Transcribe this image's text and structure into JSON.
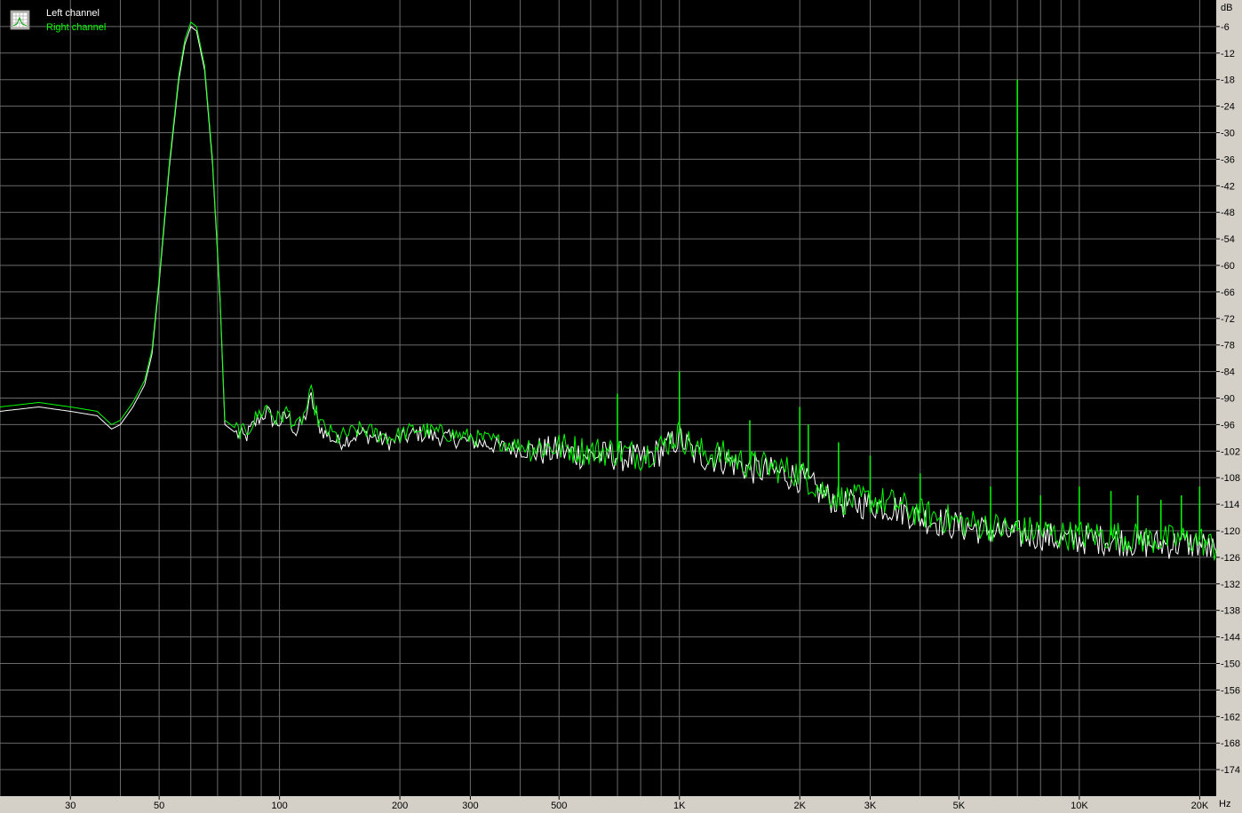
{
  "legend": {
    "left_label": "Left channel",
    "right_label": "Right channel",
    "icon": "spectrum-settings-icon"
  },
  "colors": {
    "background": "#000000",
    "grid": "#6b6b6b",
    "panel": "#d4d0c8",
    "left_channel": "#ffffff",
    "right_channel": "#00ff00",
    "left_label": "#ffffff",
    "right_label": "#00ff00"
  },
  "chart_data": {
    "type": "line",
    "x_scale": "log",
    "xlim": [
      20,
      22000
    ],
    "ylim": [
      -180,
      0
    ],
    "xlabel": "Hz",
    "ylabel": "dB",
    "y_ticks": [
      -6,
      -12,
      -18,
      -24,
      -30,
      -36,
      -42,
      -48,
      -54,
      -60,
      -66,
      -72,
      -78,
      -84,
      -90,
      -96,
      -102,
      -108,
      -114,
      -120,
      -126,
      -132,
      -138,
      -144,
      -150,
      -156,
      -162,
      -168,
      -174
    ],
    "x_tick_labels": [
      {
        "value": 30,
        "label": "30"
      },
      {
        "value": 50,
        "label": "50"
      },
      {
        "value": 100,
        "label": "100"
      },
      {
        "value": 200,
        "label": "200"
      },
      {
        "value": 300,
        "label": "300"
      },
      {
        "value": 500,
        "label": "500"
      },
      {
        "value": 1000,
        "label": "1K"
      },
      {
        "value": 2000,
        "label": "2K"
      },
      {
        "value": 3000,
        "label": "3K"
      },
      {
        "value": 5000,
        "label": "5K"
      },
      {
        "value": 10000,
        "label": "10K"
      },
      {
        "value": 20000,
        "label": "20K"
      }
    ],
    "x_gridlines": [
      20,
      30,
      40,
      50,
      60,
      70,
      80,
      90,
      100,
      200,
      300,
      400,
      500,
      600,
      700,
      800,
      900,
      1000,
      2000,
      3000,
      4000,
      5000,
      6000,
      7000,
      8000,
      9000,
      10000,
      20000
    ],
    "grid": true,
    "legend_position": "top-left",
    "series": [
      {
        "name": "Left channel",
        "color": "#ffffff",
        "points": [
          [
            20,
            -93
          ],
          [
            25,
            -92
          ],
          [
            30,
            -93
          ],
          [
            35,
            -94
          ],
          [
            38,
            -97
          ],
          [
            40,
            -96
          ],
          [
            43,
            -92
          ],
          [
            46,
            -87
          ],
          [
            48,
            -80
          ],
          [
            50,
            -64
          ],
          [
            53,
            -38
          ],
          [
            56,
            -18
          ],
          [
            58,
            -10
          ],
          [
            60,
            -6
          ],
          [
            62,
            -7
          ],
          [
            65,
            -16
          ],
          [
            68,
            -37
          ],
          [
            71,
            -68
          ],
          [
            73,
            -96
          ],
          [
            78,
            -98
          ],
          [
            82,
            -99
          ],
          [
            88,
            -95
          ],
          [
            93,
            -93
          ],
          [
            98,
            -96
          ],
          [
            105,
            -94
          ],
          [
            110,
            -98
          ],
          [
            115,
            -95
          ],
          [
            120,
            -90
          ],
          [
            125,
            -96
          ],
          [
            130,
            -98
          ],
          [
            140,
            -100
          ],
          [
            160,
            -98
          ],
          [
            190,
            -100
          ],
          [
            220,
            -98
          ],
          [
            260,
            -99
          ],
          [
            310,
            -100
          ],
          [
            360,
            -101
          ],
          [
            420,
            -102
          ],
          [
            500,
            -102
          ],
          [
            600,
            -103
          ],
          [
            700,
            -103
          ],
          [
            800,
            -104
          ],
          [
            900,
            -102
          ],
          [
            1000,
            -99
          ],
          [
            1100,
            -103
          ],
          [
            1300,
            -104
          ],
          [
            1500,
            -106
          ],
          [
            1800,
            -107
          ],
          [
            2000,
            -108
          ],
          [
            2300,
            -112
          ],
          [
            2600,
            -114
          ],
          [
            3000,
            -114
          ],
          [
            3500,
            -115
          ],
          [
            4000,
            -117
          ],
          [
            4500,
            -118
          ],
          [
            5000,
            -119
          ],
          [
            6000,
            -120
          ],
          [
            7000,
            -121
          ],
          [
            8000,
            -121
          ],
          [
            9000,
            -122
          ],
          [
            10000,
            -122
          ],
          [
            12000,
            -122
          ],
          [
            15000,
            -123
          ],
          [
            18000,
            -123
          ],
          [
            20000,
            -123
          ],
          [
            22000,
            -125
          ]
        ]
      },
      {
        "name": "Right channel",
        "color": "#00ff00",
        "points": [
          [
            20,
            -92
          ],
          [
            25,
            -91
          ],
          [
            30,
            -92
          ],
          [
            35,
            -93
          ],
          [
            38,
            -96
          ],
          [
            40,
            -95
          ],
          [
            43,
            -91
          ],
          [
            46,
            -86
          ],
          [
            48,
            -79
          ],
          [
            50,
            -63
          ],
          [
            53,
            -37
          ],
          [
            56,
            -17
          ],
          [
            58,
            -9
          ],
          [
            60,
            -5
          ],
          [
            62,
            -6
          ],
          [
            65,
            -15
          ],
          [
            68,
            -36
          ],
          [
            71,
            -67
          ],
          [
            73,
            -95
          ],
          [
            78,
            -97
          ],
          [
            82,
            -98
          ],
          [
            88,
            -94
          ],
          [
            93,
            -92
          ],
          [
            98,
            -95
          ],
          [
            105,
            -93
          ],
          [
            110,
            -97
          ],
          [
            115,
            -94
          ],
          [
            120,
            -89
          ],
          [
            125,
            -95
          ],
          [
            130,
            -97
          ],
          [
            140,
            -99
          ],
          [
            160,
            -97
          ],
          [
            190,
            -99
          ],
          [
            220,
            -97
          ],
          [
            260,
            -98
          ],
          [
            310,
            -99
          ],
          [
            360,
            -100
          ],
          [
            420,
            -101
          ],
          [
            500,
            -101
          ],
          [
            600,
            -102
          ],
          [
            700,
            -102
          ],
          [
            800,
            -103
          ],
          [
            900,
            -101
          ],
          [
            1000,
            -98
          ],
          [
            1100,
            -102
          ],
          [
            1300,
            -103
          ],
          [
            1500,
            -105
          ],
          [
            1800,
            -106
          ],
          [
            2000,
            -107
          ],
          [
            2300,
            -111
          ],
          [
            2600,
            -113
          ],
          [
            3000,
            -113
          ],
          [
            3500,
            -114
          ],
          [
            4000,
            -116
          ],
          [
            4500,
            -117
          ],
          [
            5000,
            -118
          ],
          [
            6000,
            -119
          ],
          [
            7000,
            -120
          ],
          [
            8000,
            -120
          ],
          [
            9000,
            -121
          ],
          [
            10000,
            -121
          ],
          [
            12000,
            -121
          ],
          [
            15000,
            -122
          ],
          [
            18000,
            -122
          ],
          [
            20000,
            -122
          ],
          [
            22000,
            -124
          ]
        ],
        "spikes": [
          [
            700,
            -89
          ],
          [
            1000,
            -84
          ],
          [
            1500,
            -95
          ],
          [
            2000,
            -92
          ],
          [
            2100,
            -96
          ],
          [
            2500,
            -100
          ],
          [
            3000,
            -103
          ],
          [
            4000,
            -107
          ],
          [
            6000,
            -110
          ],
          [
            7000,
            -18
          ],
          [
            8000,
            -112
          ],
          [
            10000,
            -110
          ],
          [
            12000,
            -111
          ],
          [
            14000,
            -112
          ],
          [
            16000,
            -113
          ],
          [
            18000,
            -112
          ],
          [
            20000,
            -110
          ]
        ]
      }
    ]
  }
}
